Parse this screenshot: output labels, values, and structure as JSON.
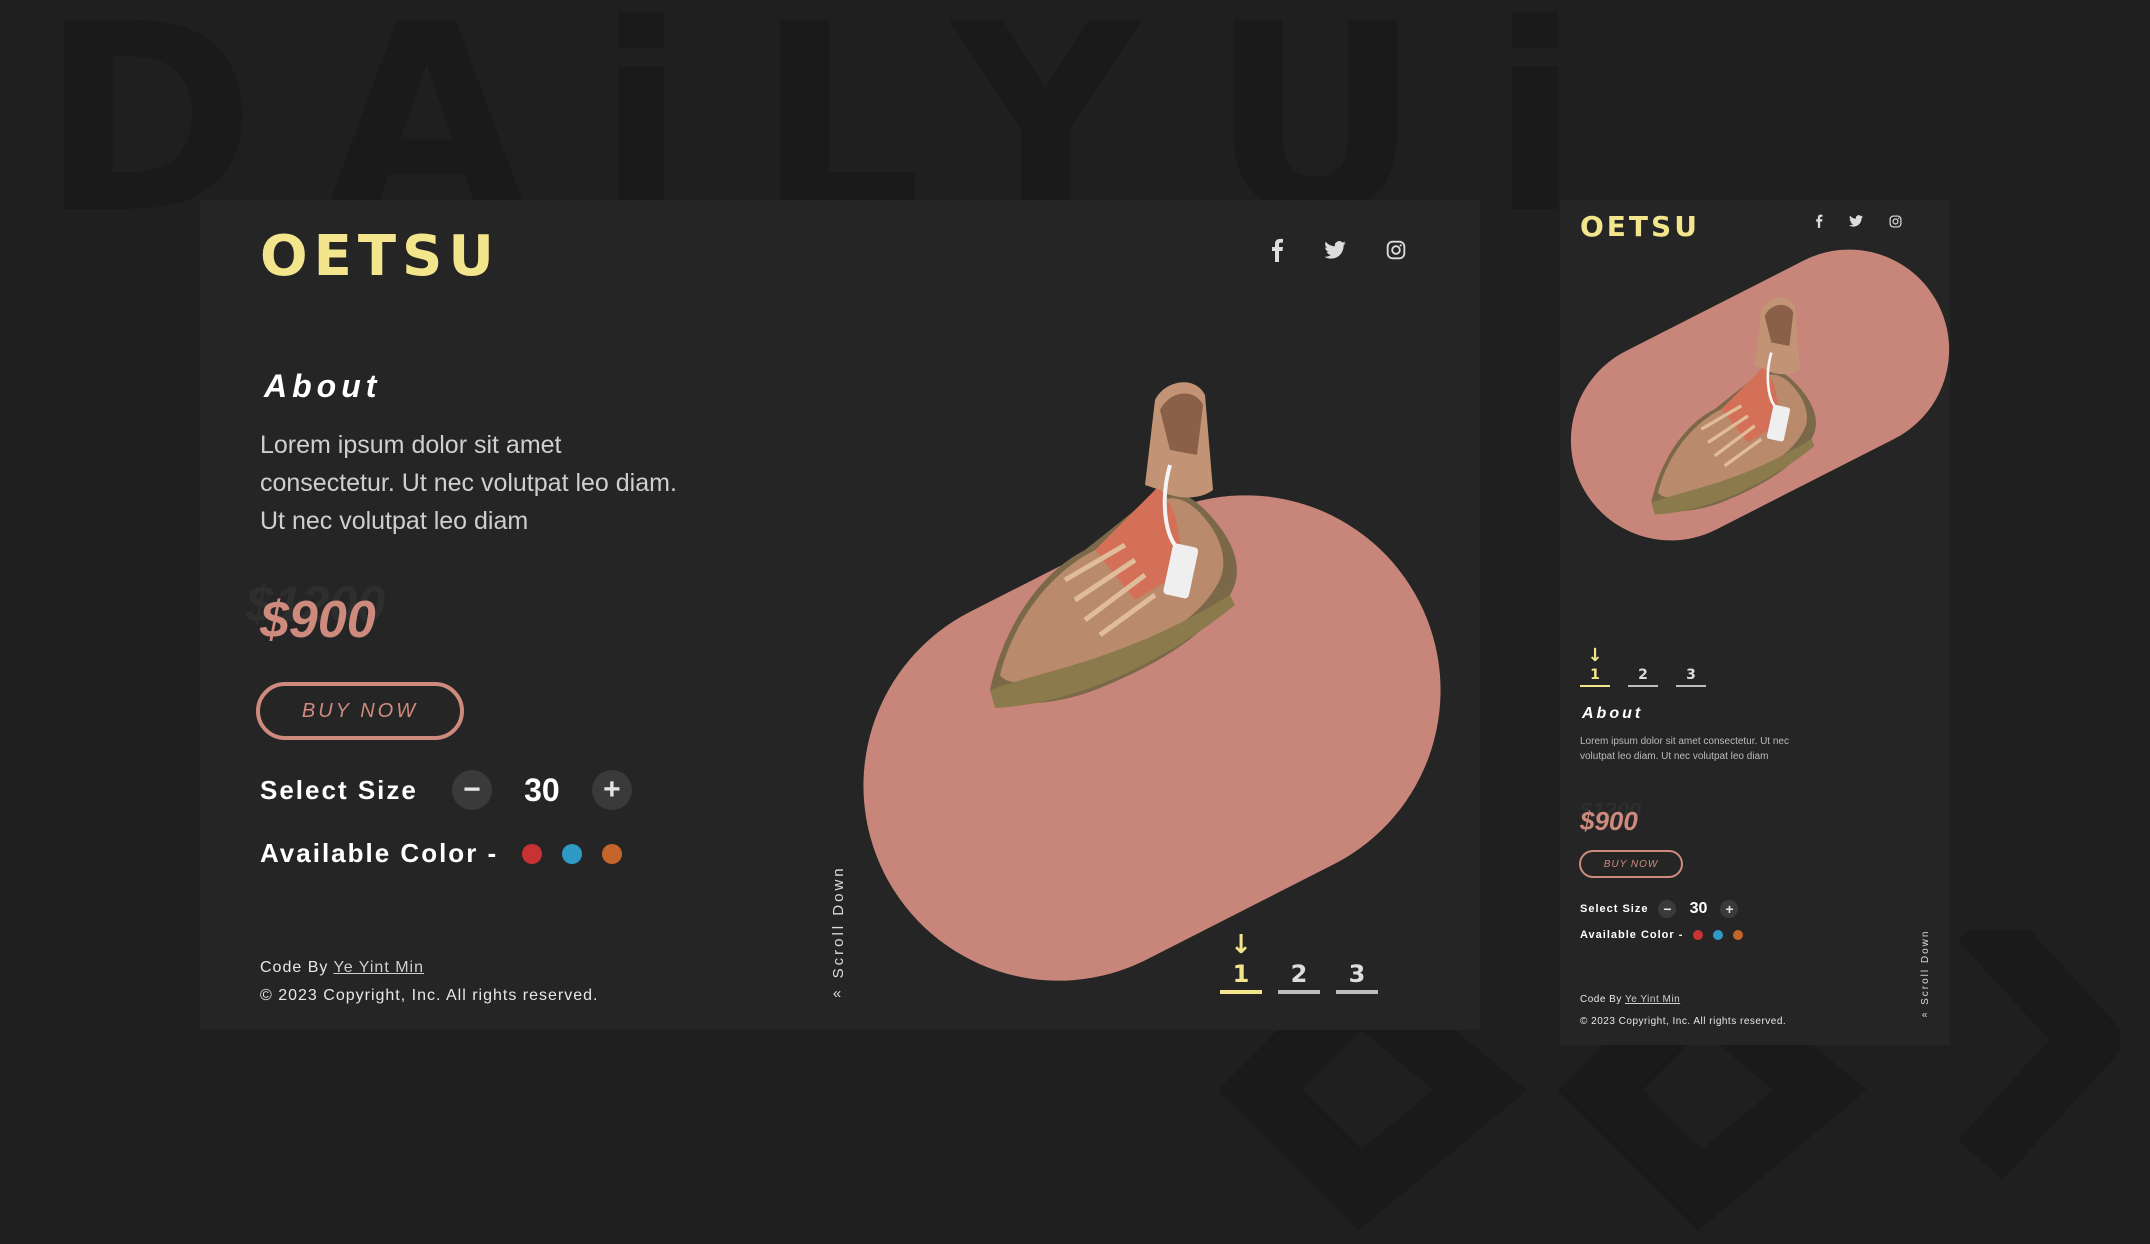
{
  "background": {
    "watermark": "DAiLYUi"
  },
  "brand": {
    "logo": "OETSU",
    "accent": "#f3e58b",
    "price_color": "#cf8a7e",
    "product_bg": "#c8867b"
  },
  "social": [
    {
      "name": "facebook-icon"
    },
    {
      "name": "twitter-icon"
    },
    {
      "name": "instagram-icon"
    }
  ],
  "about": {
    "heading": "About",
    "text": "Lorem ipsum dolor sit amet consectetur. Ut nec volutpat leo diam.  Ut nec volutpat leo diam"
  },
  "price": {
    "current": "$900",
    "old": "$1200"
  },
  "buy_label": "BUY NOW",
  "size": {
    "label": "Select Size",
    "value": "30",
    "minus": "−",
    "plus": "+"
  },
  "colors": {
    "label": "Available Color -",
    "options": [
      "#c83232",
      "#2f9ac6",
      "#c4652c"
    ]
  },
  "footer": {
    "code_by": "Code By",
    "author": "Ye Yint Min",
    "copyright": "© 2023 Copyright, Inc. All rights reserved."
  },
  "scroll": {
    "label": "Scroll Down",
    "icon": "«"
  },
  "pagination": {
    "items": [
      "1",
      "2",
      "3"
    ],
    "active": 1,
    "indicator": "↓"
  }
}
